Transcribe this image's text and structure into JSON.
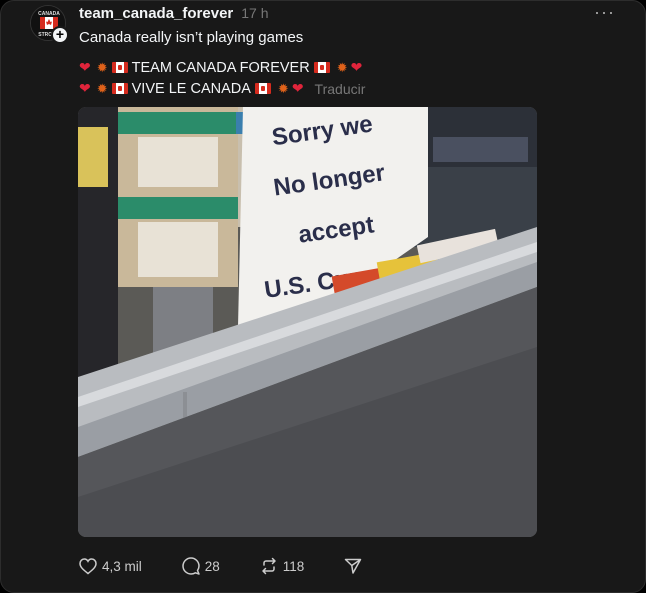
{
  "post": {
    "username": "team_canada_forever",
    "timestamp": "17 h",
    "text": "Canada really isn’t playing games",
    "line1": "TEAM CANADA FOREVER",
    "line2": "VIVE LE CANADA",
    "translate_label": "Traducir",
    "avatar_text": [
      "CANADA",
      "STRONG"
    ]
  },
  "media": {
    "sign_lines": [
      "Sorry we",
      "No longer",
      "accept",
      "U.S. Currency"
    ]
  },
  "actions": {
    "likes": "4,3 mil",
    "replies": "28",
    "reposts": "118"
  },
  "icons": {
    "heart": "heart-icon",
    "reply": "reply-icon",
    "repost": "repost-icon",
    "share": "send-icon",
    "more": "more-icon"
  },
  "colors": {
    "background": "#181818",
    "text": "#f3f5f7",
    "muted": "#777777",
    "flag_red": "#d52b1e"
  }
}
